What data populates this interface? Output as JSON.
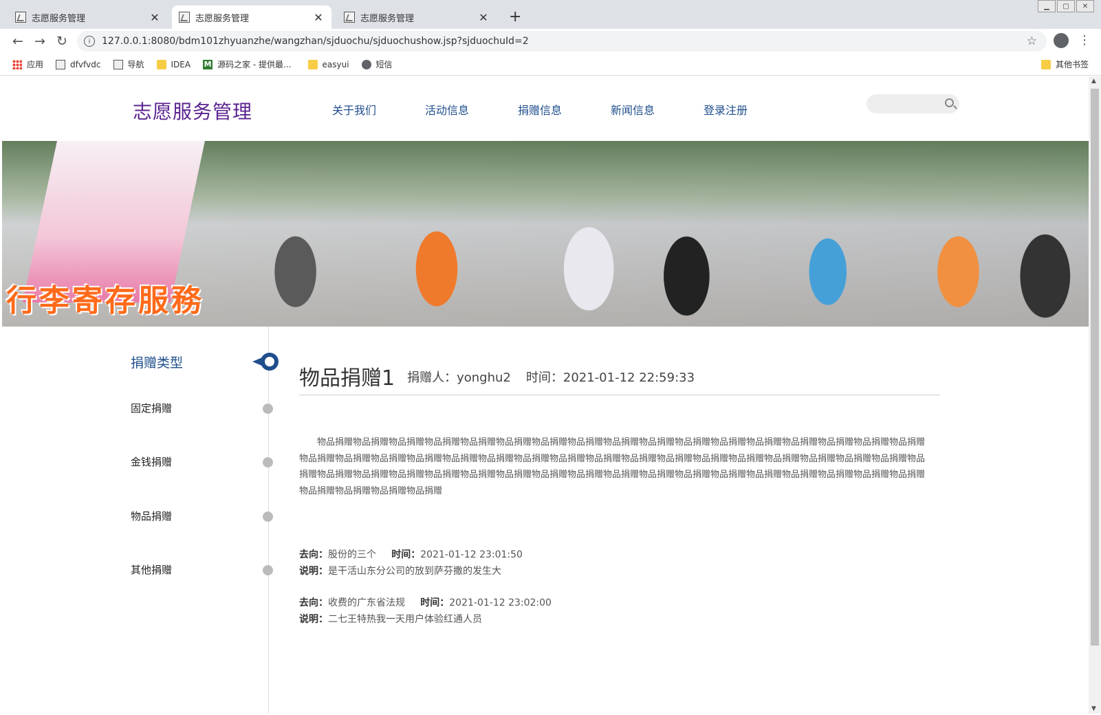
{
  "browser": {
    "tabs": [
      {
        "title": "志愿服务管理",
        "active": false
      },
      {
        "title": "志愿服务管理",
        "active": true
      },
      {
        "title": "志愿服务管理",
        "active": false
      }
    ],
    "url": "127.0.0.1:8080/bdm101zhyuanzhe/wangzhan/sjduochu/sjduochushow.jsp?sjduochuId=2",
    "bookmarks": [
      {
        "label": "应用",
        "icon": "apps-icon"
      },
      {
        "label": "dfvfvdc",
        "icon": "page-icon"
      },
      {
        "label": "导航",
        "icon": "page-icon"
      },
      {
        "label": "IDEA",
        "icon": "folder-icon"
      },
      {
        "label": "源码之家 - 提供最...",
        "icon": "m-logo-icon"
      },
      {
        "label": "easyui",
        "icon": "folder-icon"
      },
      {
        "label": "短信",
        "icon": "globe-icon"
      }
    ],
    "other_bookmarks": "其他书签"
  },
  "site": {
    "logo": "志愿服务管理",
    "nav": [
      "关于我们",
      "活动信息",
      "捐赠信息",
      "新闻信息",
      "登录注册"
    ],
    "search_placeholder": ""
  },
  "banner": {
    "text": "行李寄存服務"
  },
  "sidebar": {
    "title": "捐赠类型",
    "items": [
      "固定捐赠",
      "金钱捐赠",
      "物品捐赠",
      "其他捐赠"
    ]
  },
  "article": {
    "title": "物品捐赠1",
    "donor": "捐赠人：yonghu2",
    "time": "时间：2021-01-12 22:59:33",
    "body": "物品捐赠物品捐赠物品捐赠物品捐赠物品捐赠物品捐赠物品捐赠物品捐赠物品捐赠物品捐赠物品捐赠物品捐赠物品捐赠物品捐赠物品捐赠物品捐赠物品捐赠物品捐赠物品捐赠物品捐赠物品捐赠物品捐赠物品捐赠物品捐赠物品捐赠物品捐赠物品捐赠物品捐赠物品捐赠物品捐赠物品捐赠物品捐赠物品捐赠物品捐赠物品捐赠物品捐赠物品捐赠物品捐赠物品捐赠物品捐赠物品捐赠物品捐赠物品捐赠物品捐赠物品捐赠物品捐赠物品捐赠物品捐赠物品捐赠物品捐赠物品捐赠物品捐赠物品捐赠物品捐赠物品捐赠物品捐赠",
    "flows": [
      {
        "dest_label": "去向：",
        "dest": "股份的三个",
        "time_label": "时间：",
        "time": "2021-01-12 23:01:50",
        "note_label": "说明：",
        "note": "是干活山东分公司的放到萨芬撒的发生大"
      },
      {
        "dest_label": "去向：",
        "dest": "收费的广东省法规",
        "time_label": "时间：",
        "time": "2021-01-12 23:02:00",
        "note_label": "说明：",
        "note": "二七王特热我一天用户体验红通人员"
      }
    ]
  }
}
